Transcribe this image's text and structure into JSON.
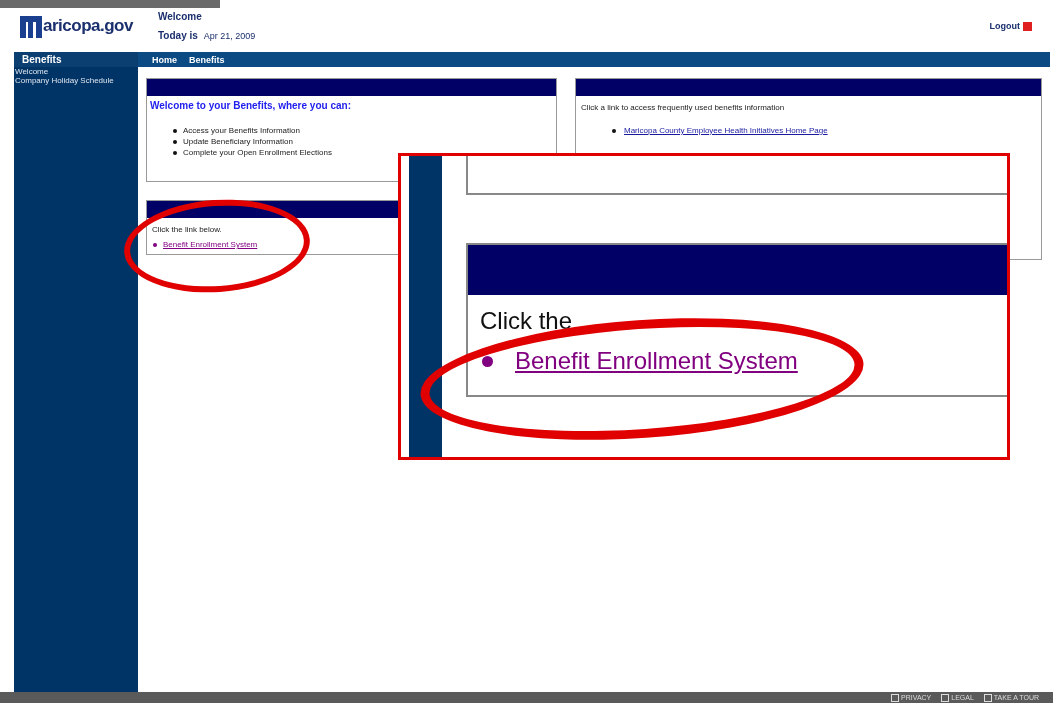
{
  "header": {
    "logo": "aricopa.gov",
    "welcome": "Welcome",
    "today_label": "Today is",
    "date": "Apr 21, 2009",
    "logout": "Logout"
  },
  "sidebar": {
    "title": "Benefits",
    "items": [
      "Welcome",
      "Company Holiday Schedule"
    ]
  },
  "nav": [
    "Home",
    "Benefits"
  ],
  "welcome_panel": {
    "heading": "Welcome to your Benefits, where you can:",
    "items": [
      "Access your Benefits Information",
      "Update Beneficiary Information",
      "Complete your Open Enrollment Elections"
    ]
  },
  "links_panel": {
    "intro": "Click a link to access frequently used benefits information",
    "links": [
      "Maricopa County Employee Health Initiatives Home Page"
    ]
  },
  "enroll_panel": {
    "intro": "Click the link below.",
    "links": [
      "Benefit Enrollment System"
    ]
  },
  "inset": {
    "intro": "Click the",
    "links": [
      "Benefit Enrollment System"
    ]
  },
  "footer": [
    "PRIVACY",
    "LEGAL",
    "TAKE A TOUR"
  ]
}
